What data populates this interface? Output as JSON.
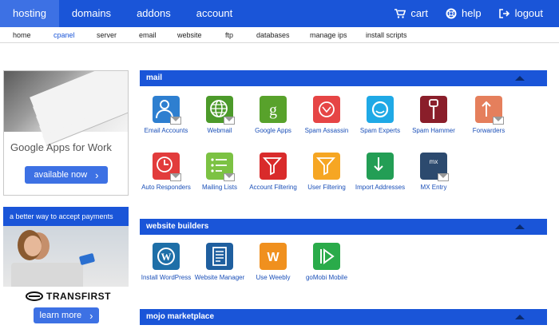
{
  "topnav": {
    "left": [
      "hosting",
      "domains",
      "addons",
      "account"
    ],
    "active": "hosting",
    "right": [
      {
        "label": "cart",
        "icon": "cart-icon"
      },
      {
        "label": "help",
        "icon": "lifebuoy-icon"
      },
      {
        "label": "logout",
        "icon": "logout-icon"
      }
    ]
  },
  "subnav": [
    "home",
    "cpanel",
    "server",
    "email",
    "website",
    "ftp",
    "databases",
    "manage ips",
    "install scripts"
  ],
  "subnav_active": "cpanel",
  "ads": {
    "google_apps": {
      "title_google": "Google",
      "title_rest": " Apps for Work",
      "button": "available now"
    },
    "transfirst": {
      "headline": "a better way to accept payments",
      "brand": "TRANSFIRST",
      "button": "learn more"
    }
  },
  "sections": {
    "mail": {
      "title": "mail",
      "items": [
        {
          "label": "Email Accounts",
          "icon": "user-icon",
          "color": "#2e7fd0"
        },
        {
          "label": "Webmail",
          "icon": "globe-icon",
          "color": "#4c9a2a"
        },
        {
          "label": "Google Apps",
          "icon": "google-g-icon",
          "color": "#58a22b"
        },
        {
          "label": "Spam Assassin",
          "icon": "spam-assassin-icon",
          "color": "#e64545"
        },
        {
          "label": "Spam Experts",
          "icon": "spam-experts-icon",
          "color": "#1fa9e6"
        },
        {
          "label": "Spam Hammer",
          "icon": "hammer-icon",
          "color": "#8a1e2a"
        },
        {
          "label": "Forwarders",
          "icon": "forward-arrow-icon",
          "color": "#e57f5c"
        },
        {
          "label": "Auto Responders",
          "icon": "clock-icon",
          "color": "#e23c3c"
        },
        {
          "label": "Mailing Lists",
          "icon": "list-icon",
          "color": "#7cc243"
        },
        {
          "label": "Account Filtering",
          "icon": "funnel-icon",
          "color": "#d92b2b"
        },
        {
          "label": "User Filtering",
          "icon": "funnel-user-icon",
          "color": "#f6a623"
        },
        {
          "label": "Import Addresses",
          "icon": "import-icon",
          "color": "#239e55"
        },
        {
          "label": "MX Entry",
          "icon": "mx-entry-icon",
          "color": "#2c4a6e"
        }
      ]
    },
    "website_builders": {
      "title": "website builders",
      "items": [
        {
          "label": "Install WordPress",
          "icon": "wordpress-icon",
          "color": "#1e6fa8"
        },
        {
          "label": "Website Manager",
          "icon": "document-icon",
          "color": "#1f5f9f"
        },
        {
          "label": "Use Weebly",
          "icon": "weebly-icon",
          "color": "#f0901e"
        },
        {
          "label": "goMobi Mobile",
          "icon": "gomobi-icon",
          "color": "#2aab4a"
        }
      ]
    },
    "mojo": {
      "title": "mojo marketplace"
    }
  }
}
